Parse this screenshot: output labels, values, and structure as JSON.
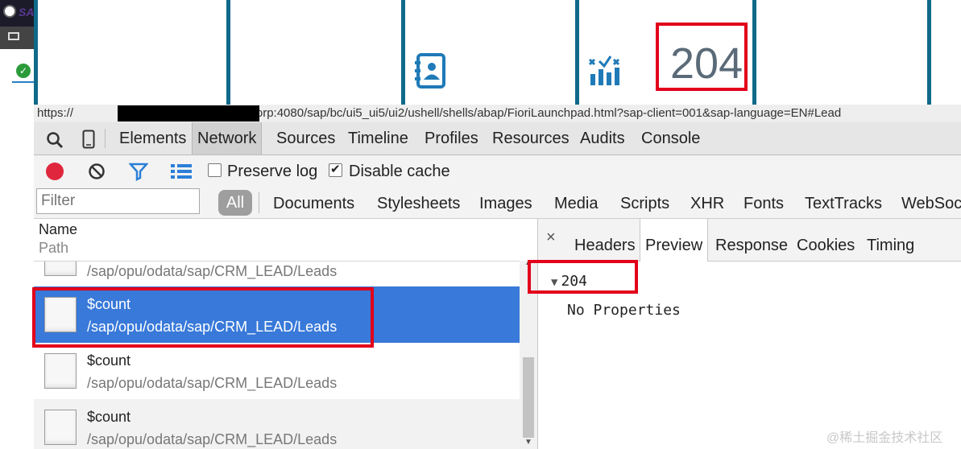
{
  "launchpad": {
    "kpi_value": "204"
  },
  "url": {
    "prefix": "https://",
    "rest": "sap.corp:4080/sap/bc/ui5_ui5/ui2/ushell/shells/abap/FioriLaunchpad.html?sap-client=001&sap-language=EN#Lead"
  },
  "devtools": {
    "tabs": [
      "Elements",
      "Network",
      "Sources",
      "Timeline",
      "Profiles",
      "Resources",
      "Audits",
      "Console"
    ],
    "active_tab": "Network"
  },
  "controls": {
    "preserve_log": "Preserve log",
    "disable_cache": "Disable cache",
    "preserve_log_checked": false,
    "disable_cache_checked": true
  },
  "filter": {
    "placeholder": "Filter",
    "types": [
      "All",
      "Documents",
      "Stylesheets",
      "Images",
      "Media",
      "Scripts",
      "XHR",
      "Fonts",
      "TextTracks",
      "WebSoc"
    ]
  },
  "request_list": {
    "col_name": "Name",
    "col_path": "Path",
    "rows": [
      {
        "name": "",
        "path": "/sap/opu/odata/sap/CRM_LEAD/Leads"
      },
      {
        "name": "$count",
        "path": "/sap/opu/odata/sap/CRM_LEAD/Leads"
      },
      {
        "name": "$count",
        "path": "/sap/opu/odata/sap/CRM_LEAD/Leads"
      },
      {
        "name": "$count",
        "path": "/sap/opu/odata/sap/CRM_LEAD/Leads"
      }
    ]
  },
  "detail": {
    "close": "×",
    "tabs": [
      "Headers",
      "Preview",
      "Response",
      "Cookies",
      "Timing"
    ],
    "active_tab": "Preview",
    "tree_value": "204",
    "no_properties": "No Properties"
  },
  "watermark": "@稀土掘金技术社区",
  "colors": {
    "highlight_red": "#e2001a",
    "selected_row": "#3879d9",
    "record": "#e0263d",
    "tile_separator": "#0f6a8a"
  }
}
